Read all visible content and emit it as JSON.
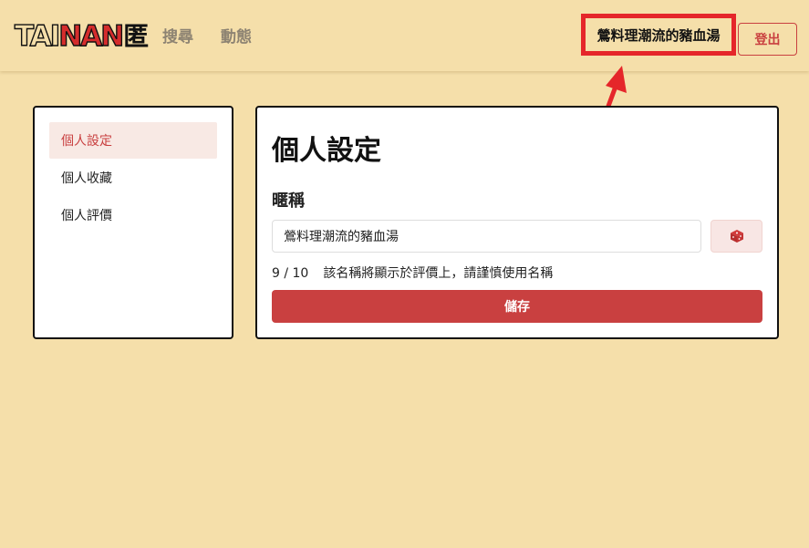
{
  "header": {
    "logo": {
      "part1": "TAI",
      "part2": "NAN",
      "kanji": "匿"
    },
    "nav": [
      {
        "label": "搜尋"
      },
      {
        "label": "動態"
      }
    ],
    "user_name": "鶯料理潮流的豬血湯",
    "logout_label": "登出"
  },
  "sidebar": {
    "items": [
      {
        "label": "個人設定",
        "active": true
      },
      {
        "label": "個人收藏",
        "active": false
      },
      {
        "label": "個人評價",
        "active": false
      }
    ]
  },
  "main": {
    "title": "個人設定",
    "nickname_label": "暱稱",
    "nickname_value": "鶯料理潮流的豬血湯",
    "char_count": "9 / 10",
    "helper_text": "該名稱將顯示於評價上，請謹慎使用名稱",
    "save_label": "儲存",
    "dice_icon": "dice-icon"
  },
  "colors": {
    "background": "#f5dfaa",
    "accent": "#c94040",
    "highlight": "#e5262a"
  }
}
